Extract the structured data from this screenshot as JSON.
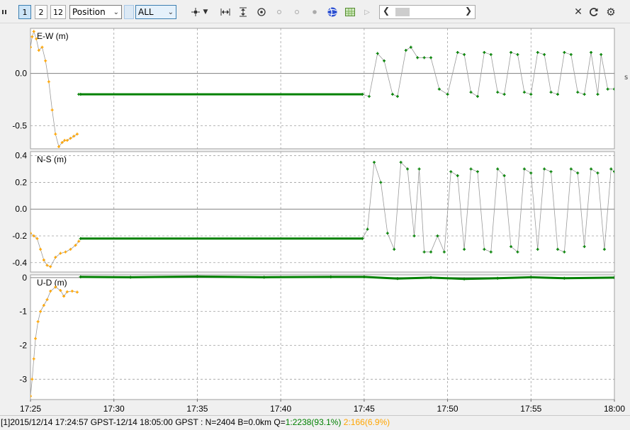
{
  "toolbar": {
    "plot_button_1": "1",
    "plot_button_2": "2",
    "plot_button_12": "12",
    "plot_type": "Position",
    "satellite_filter": "ALL",
    "icons": [
      "pan-icon",
      "dropdown-icon",
      "fit-horizontal-icon",
      "fit-vertical-icon",
      "center-icon",
      "point-icon",
      "point-icon",
      "point-icon",
      "globe-icon",
      "map-icon",
      "play-icon",
      "scroll-left-icon",
      "scroll-right-icon",
      "close-icon",
      "refresh-icon",
      "gear-icon"
    ]
  },
  "status": {
    "prefix": "[1]2015/12/14 17:24:57 GPST-12/14 18:05:00 GPST : N=2404 B=0.0km Q=",
    "q1": "1:2238(93.1%)",
    "q2": "2:166(6.9%)"
  },
  "side_letter": "s",
  "colors": {
    "fix": "#008000",
    "float": "#ffa500",
    "grid": "#a0a0a0",
    "zero": "#808080"
  },
  "chart_data": {
    "type": "scatter",
    "time_range_min": [
      0,
      35
    ],
    "x_tick_labels": [
      "17:25",
      "17:30",
      "17:35",
      "17:40",
      "17:45",
      "17:50",
      "17:55",
      "18:00",
      "18:0"
    ],
    "grid": true,
    "series_legend": [
      {
        "name": "1",
        "color": "#008000"
      },
      {
        "name": "2",
        "color": "#ffa500"
      }
    ],
    "panels": [
      {
        "label": "E-W (m)",
        "ylim": [
          -0.72,
          0.43
        ],
        "y_ticks": [
          0.0,
          -0.5
        ],
        "y_tick_labels": [
          "0.0",
          "-0.5"
        ],
        "series": [
          {
            "name": "2",
            "t": [
              0.0,
              0.1,
              0.2,
              0.35,
              0.5,
              0.7,
              0.9,
              1.1,
              1.3,
              1.5,
              1.7,
              1.9,
              2.05,
              2.2,
              2.4,
              2.6,
              2.8
            ],
            "v": [
              0.25,
              0.35,
              0.4,
              0.33,
              0.22,
              0.25,
              0.12,
              -0.08,
              -0.35,
              -0.58,
              -0.7,
              -0.66,
              -0.64,
              -0.64,
              -0.62,
              -0.6,
              -0.58
            ]
          },
          {
            "name": "1",
            "t": [
              2.9,
              3.0,
              19.9,
              20.3,
              20.8,
              21.2,
              21.7,
              22.0,
              22.5,
              22.8,
              23.2,
              23.6,
              24.0,
              24.5,
              25.0,
              25.6,
              26.0,
              26.4,
              26.8,
              27.2,
              27.6,
              28.0,
              28.4,
              28.8,
              29.2,
              29.6,
              30.0,
              30.4,
              30.8,
              31.2,
              31.6,
              32.0,
              32.4,
              32.8,
              33.2,
              33.6,
              34.0,
              34.2,
              34.6,
              35.0
            ],
            "v": [
              -0.2,
              -0.2,
              -0.2,
              -0.22,
              0.19,
              0.12,
              -0.2,
              -0.22,
              0.22,
              0.25,
              0.15,
              0.15,
              0.15,
              -0.15,
              -0.2,
              0.2,
              0.18,
              -0.18,
              -0.22,
              0.2,
              0.18,
              -0.18,
              -0.2,
              0.2,
              0.18,
              -0.18,
              -0.2,
              0.2,
              0.18,
              -0.18,
              -0.2,
              0.2,
              0.18,
              -0.18,
              -0.2,
              0.2,
              -0.2,
              0.18,
              -0.15,
              -0.15
            ]
          }
        ]
      },
      {
        "label": "N-S (m)",
        "ylim": [
          -0.47,
          0.43
        ],
        "y_ticks": [
          0.4,
          0.2,
          0.0,
          -0.2,
          -0.4
        ],
        "y_tick_labels": [
          "0.4",
          "0.2",
          "0.0",
          "-0.2",
          "-0.4"
        ],
        "series": [
          {
            "name": "2",
            "t": [
              0.0,
              0.2,
              0.4,
              0.6,
              0.8,
              1.0,
              1.2,
              1.5,
              1.8,
              2.1,
              2.4,
              2.7,
              2.9
            ],
            "v": [
              -0.18,
              -0.2,
              -0.22,
              -0.3,
              -0.38,
              -0.42,
              -0.43,
              -0.36,
              -0.33,
              -0.32,
              -0.3,
              -0.27,
              -0.24
            ]
          },
          {
            "name": "1",
            "t": [
              3.0,
              19.9,
              20.2,
              20.6,
              21.0,
              21.4,
              21.8,
              22.2,
              22.6,
              23.0,
              23.3,
              23.6,
              24.0,
              24.4,
              24.8,
              25.2,
              25.6,
              26.0,
              26.4,
              26.8,
              27.2,
              27.6,
              28.0,
              28.4,
              28.8,
              29.2,
              29.6,
              30.0,
              30.4,
              30.8,
              31.2,
              31.6,
              32.0,
              32.4,
              32.8,
              33.2,
              33.6,
              34.0,
              34.4,
              34.8,
              35.0
            ],
            "v": [
              -0.22,
              -0.22,
              -0.15,
              0.35,
              0.2,
              -0.18,
              -0.3,
              0.35,
              0.3,
              -0.2,
              0.3,
              -0.32,
              -0.32,
              -0.2,
              -0.32,
              0.28,
              0.25,
              -0.3,
              0.3,
              0.28,
              -0.3,
              -0.32,
              0.3,
              0.25,
              -0.28,
              -0.32,
              0.3,
              0.27,
              -0.3,
              0.3,
              0.28,
              -0.3,
              -0.32,
              0.3,
              0.27,
              -0.28,
              0.3,
              0.27,
              -0.3,
              0.3,
              0.28
            ]
          }
        ]
      },
      {
        "label": "U-D (m)",
        "ylim": [
          -3.6,
          0.08
        ],
        "y_ticks": [
          0,
          -1,
          -2,
          -3
        ],
        "y_tick_labels": [
          "0",
          "-1",
          "-2",
          "-3"
        ],
        "series": [
          {
            "name": "2",
            "t": [
              0.0,
              0.1,
              0.2,
              0.3,
              0.45,
              0.6,
              0.8,
              1.0,
              1.2,
              1.5,
              1.8,
              2.0,
              2.2,
              2.5,
              2.8
            ],
            "v": [
              -3.5,
              -3.0,
              -2.4,
              -1.8,
              -1.3,
              -1.0,
              -0.82,
              -0.65,
              -0.4,
              -0.28,
              -0.38,
              -0.55,
              -0.42,
              -0.4,
              -0.43
            ]
          },
          {
            "name": "1",
            "t": [
              3.0,
              6.0,
              10.0,
              14.0,
              18.0,
              20.0,
              22.0,
              24.0,
              26.0,
              28.0,
              30.0,
              32.0,
              35.0
            ],
            "v": [
              0.02,
              0.01,
              0.03,
              0.01,
              0.02,
              0.02,
              -0.03,
              0.0,
              -0.04,
              -0.02,
              0.01,
              -0.02,
              0.0
            ]
          }
        ]
      }
    ]
  }
}
